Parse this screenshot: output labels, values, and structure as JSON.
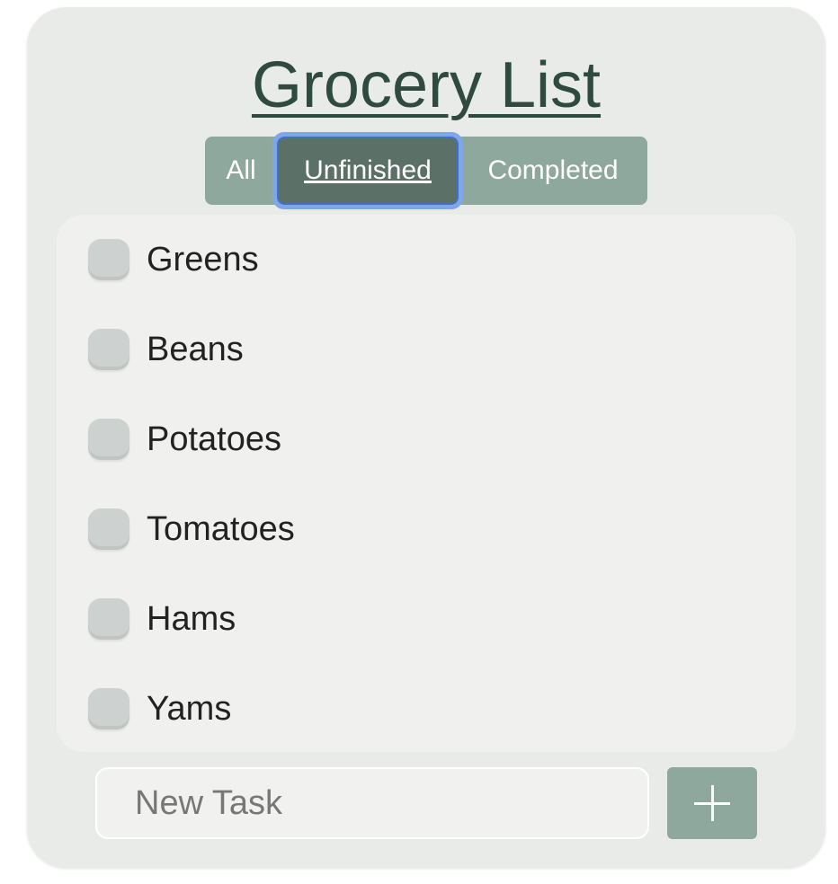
{
  "app": {
    "title": "Grocery List"
  },
  "filters": {
    "items": [
      {
        "label": "All",
        "active": false
      },
      {
        "label": "Unfinished",
        "active": true
      },
      {
        "label": "Completed",
        "active": false
      }
    ]
  },
  "tasks": [
    {
      "label": "Greens",
      "checked": false
    },
    {
      "label": "Beans",
      "checked": false
    },
    {
      "label": "Potatoes",
      "checked": false
    },
    {
      "label": "Tomatoes",
      "checked": false
    },
    {
      "label": "Hams",
      "checked": false
    },
    {
      "label": "Yams",
      "checked": false
    }
  ],
  "new_task": {
    "placeholder": "New Task",
    "value": ""
  },
  "add_button": {
    "icon": "plus-icon"
  },
  "colors": {
    "accent": "#8fa89d",
    "active_filter": "#5b7168",
    "title": "#2f4a40",
    "focus_ring": "#7fa6e8"
  }
}
